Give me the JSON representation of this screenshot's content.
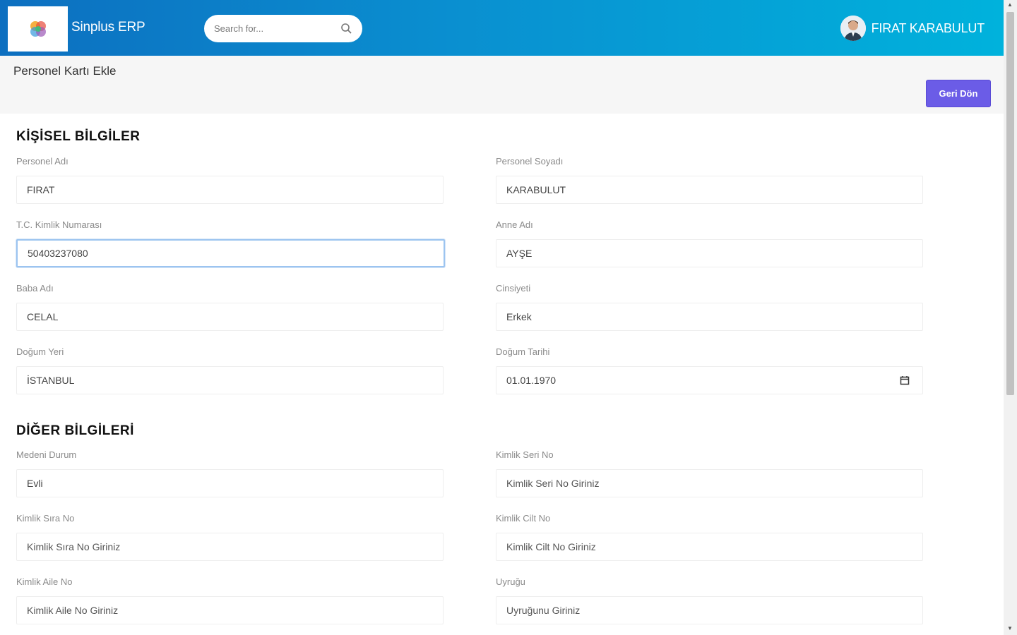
{
  "header": {
    "brand": "Sinplus ERP",
    "search_placeholder": "Search for...",
    "username": "FIRAT KARABULUT"
  },
  "subheader": {
    "title": "Personel Kartı Ekle",
    "back_button": "Geri Dön"
  },
  "sections": {
    "personal": "KİŞİSEL BİLGİLER",
    "other": "DİĞER BİLGİLERİ"
  },
  "fields": {
    "first_name": {
      "label": "Personel Adı",
      "value": "FIRAT"
    },
    "last_name": {
      "label": "Personel Soyadı",
      "value": "KARABULUT"
    },
    "tc_no": {
      "label": "T.C. Kimlik Numarası",
      "value": "50403237080"
    },
    "mother_name": {
      "label": "Anne Adı",
      "value": "AYŞE"
    },
    "father_name": {
      "label": "Baba Adı",
      "value": "CELAL"
    },
    "gender": {
      "label": "Cinsiyeti",
      "value": "Erkek"
    },
    "birth_place": {
      "label": "Doğum Yeri",
      "value": "İSTANBUL"
    },
    "birth_date": {
      "label": "Doğum Tarihi",
      "value": "01.01.1970"
    },
    "marital_status": {
      "label": "Medeni Durum",
      "value": "Evli"
    },
    "id_serial_no": {
      "label": "Kimlik Seri No",
      "placeholder": "Kimlik Seri No Giriniz"
    },
    "id_sequence_no": {
      "label": "Kimlik Sıra No",
      "placeholder": "Kimlik Sıra No Giriniz"
    },
    "id_volume_no": {
      "label": "Kimlik Cilt No",
      "placeholder": "Kimlik Cilt No Giriniz"
    },
    "id_family_no": {
      "label": "Kimlik Aile No",
      "placeholder": "Kimlik Aile No Giriniz"
    },
    "nationality": {
      "label": "Uyruğu",
      "placeholder": "Uyruğunu Giriniz"
    }
  },
  "colors": {
    "header_start": "#0d6fc0",
    "header_end": "#00b2dc",
    "back_button": "#6b5ce7",
    "focus_border": "#9cc4f0"
  },
  "icons": [
    "sinplus-logo-icon",
    "search-icon",
    "user-avatar-icon",
    "calendar-icon"
  ]
}
